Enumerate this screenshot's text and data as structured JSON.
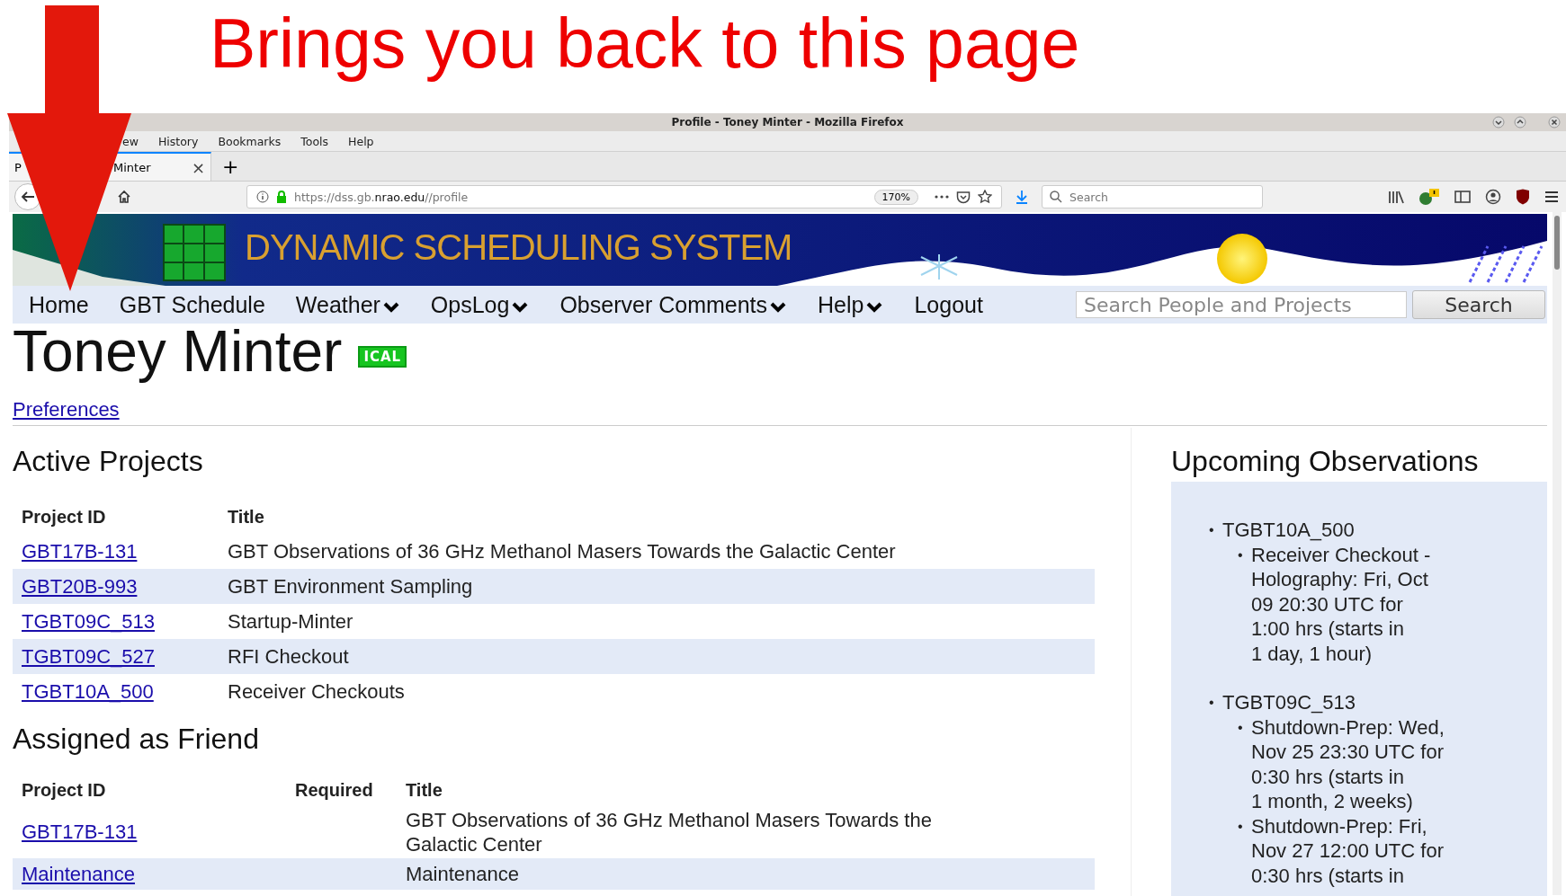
{
  "annotation": {
    "text": "Brings you back to this page"
  },
  "window": {
    "title": "Profile - Toney Minter - Mozilla Firefox"
  },
  "menu_bar": [
    "ew",
    "History",
    "Bookmarks",
    "Tools",
    "Help"
  ],
  "tab": {
    "label_parts": [
      "P",
      "Minter"
    ],
    "close": "×",
    "new_tab": "+"
  },
  "toolbar": {
    "url_host_prefix": "https://dss.gb.",
    "url_host": "nrao.edu",
    "url_path": "//profile",
    "zoom": "170%",
    "search_placeholder": "Search"
  },
  "banner": {
    "title": "DYNAMIC SCHEDULING SYSTEM"
  },
  "nav": [
    {
      "label": "Home",
      "dropdown": false
    },
    {
      "label": "GBT Schedule",
      "dropdown": false
    },
    {
      "label": "Weather",
      "dropdown": true
    },
    {
      "label": "OpsLog",
      "dropdown": true
    },
    {
      "label": "Observer Comments",
      "dropdown": true
    },
    {
      "label": "Help",
      "dropdown": true
    },
    {
      "label": "Logout",
      "dropdown": false
    }
  ],
  "site_search": {
    "placeholder": "Search People and Projects",
    "button": "Search"
  },
  "profile": {
    "name": "Toney Minter",
    "badge": "ICAL",
    "preferences_link": "Preferences"
  },
  "active_projects": {
    "heading": "Active Projects",
    "columns": [
      "Project ID",
      "Title"
    ],
    "rows": [
      {
        "id": "GBT17B-131",
        "title": "GBT Observations of 36 GHz Methanol Masers Towards the Galactic Center"
      },
      {
        "id": "GBT20B-993",
        "title": "GBT Environment Sampling"
      },
      {
        "id": "TGBT09C_513",
        "title": "Startup-Minter"
      },
      {
        "id": "TGBT09C_527",
        "title": "RFI Checkout"
      },
      {
        "id": "TGBT10A_500",
        "title": "Receiver Checkouts"
      }
    ]
  },
  "assigned_as_friend": {
    "heading": "Assigned as Friend",
    "columns": [
      "Project ID",
      "Required",
      "Title"
    ],
    "rows": [
      {
        "id": "GBT17B-131",
        "required": "",
        "title": "GBT Observations of 36 GHz Methanol Masers Towards the Galactic Center"
      },
      {
        "id": "Maintenance",
        "required": "",
        "title": "Maintenance"
      }
    ]
  },
  "upcoming_observations": {
    "heading": "Upcoming Observations",
    "bullet": "•",
    "sub_bullet": "•",
    "items": [
      {
        "project": "TGBT10A_500",
        "sessions": [
          "Receiver Checkout - Holography: Fri, Oct 09 20:30 UTC for 1:00 hrs (starts in 1 day, 1 hour)"
        ]
      },
      {
        "project": "TGBT09C_513",
        "sessions": [
          "Shutdown-Prep: Wed, Nov 25 23:30 UTC for 0:30 hrs (starts in 1 month, 2 weeks)",
          "Shutdown-Prep: Fri, Nov 27 12:00 UTC for 0:30 hrs (starts in"
        ]
      }
    ]
  }
}
